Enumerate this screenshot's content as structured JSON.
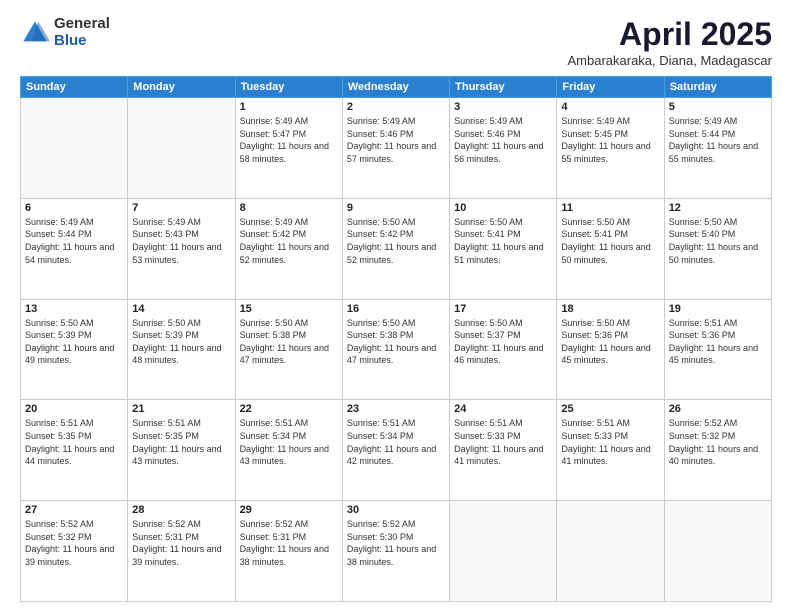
{
  "header": {
    "logo_general": "General",
    "logo_blue": "Blue",
    "month_title": "April 2025",
    "location": "Ambarakaraka, Diana, Madagascar"
  },
  "weekdays": [
    "Sunday",
    "Monday",
    "Tuesday",
    "Wednesday",
    "Thursday",
    "Friday",
    "Saturday"
  ],
  "weeks": [
    [
      {
        "day": "",
        "info": ""
      },
      {
        "day": "",
        "info": ""
      },
      {
        "day": "1",
        "info": "Sunrise: 5:49 AM\nSunset: 5:47 PM\nDaylight: 11 hours and 58 minutes."
      },
      {
        "day": "2",
        "info": "Sunrise: 5:49 AM\nSunset: 5:46 PM\nDaylight: 11 hours and 57 minutes."
      },
      {
        "day": "3",
        "info": "Sunrise: 5:49 AM\nSunset: 5:46 PM\nDaylight: 11 hours and 56 minutes."
      },
      {
        "day": "4",
        "info": "Sunrise: 5:49 AM\nSunset: 5:45 PM\nDaylight: 11 hours and 55 minutes."
      },
      {
        "day": "5",
        "info": "Sunrise: 5:49 AM\nSunset: 5:44 PM\nDaylight: 11 hours and 55 minutes."
      }
    ],
    [
      {
        "day": "6",
        "info": "Sunrise: 5:49 AM\nSunset: 5:44 PM\nDaylight: 11 hours and 54 minutes."
      },
      {
        "day": "7",
        "info": "Sunrise: 5:49 AM\nSunset: 5:43 PM\nDaylight: 11 hours and 53 minutes."
      },
      {
        "day": "8",
        "info": "Sunrise: 5:49 AM\nSunset: 5:42 PM\nDaylight: 11 hours and 52 minutes."
      },
      {
        "day": "9",
        "info": "Sunrise: 5:50 AM\nSunset: 5:42 PM\nDaylight: 11 hours and 52 minutes."
      },
      {
        "day": "10",
        "info": "Sunrise: 5:50 AM\nSunset: 5:41 PM\nDaylight: 11 hours and 51 minutes."
      },
      {
        "day": "11",
        "info": "Sunrise: 5:50 AM\nSunset: 5:41 PM\nDaylight: 11 hours and 50 minutes."
      },
      {
        "day": "12",
        "info": "Sunrise: 5:50 AM\nSunset: 5:40 PM\nDaylight: 11 hours and 50 minutes."
      }
    ],
    [
      {
        "day": "13",
        "info": "Sunrise: 5:50 AM\nSunset: 5:39 PM\nDaylight: 11 hours and 49 minutes."
      },
      {
        "day": "14",
        "info": "Sunrise: 5:50 AM\nSunset: 5:39 PM\nDaylight: 11 hours and 48 minutes."
      },
      {
        "day": "15",
        "info": "Sunrise: 5:50 AM\nSunset: 5:38 PM\nDaylight: 11 hours and 47 minutes."
      },
      {
        "day": "16",
        "info": "Sunrise: 5:50 AM\nSunset: 5:38 PM\nDaylight: 11 hours and 47 minutes."
      },
      {
        "day": "17",
        "info": "Sunrise: 5:50 AM\nSunset: 5:37 PM\nDaylight: 11 hours and 46 minutes."
      },
      {
        "day": "18",
        "info": "Sunrise: 5:50 AM\nSunset: 5:36 PM\nDaylight: 11 hours and 45 minutes."
      },
      {
        "day": "19",
        "info": "Sunrise: 5:51 AM\nSunset: 5:36 PM\nDaylight: 11 hours and 45 minutes."
      }
    ],
    [
      {
        "day": "20",
        "info": "Sunrise: 5:51 AM\nSunset: 5:35 PM\nDaylight: 11 hours and 44 minutes."
      },
      {
        "day": "21",
        "info": "Sunrise: 5:51 AM\nSunset: 5:35 PM\nDaylight: 11 hours and 43 minutes."
      },
      {
        "day": "22",
        "info": "Sunrise: 5:51 AM\nSunset: 5:34 PM\nDaylight: 11 hours and 43 minutes."
      },
      {
        "day": "23",
        "info": "Sunrise: 5:51 AM\nSunset: 5:34 PM\nDaylight: 11 hours and 42 minutes."
      },
      {
        "day": "24",
        "info": "Sunrise: 5:51 AM\nSunset: 5:33 PM\nDaylight: 11 hours and 41 minutes."
      },
      {
        "day": "25",
        "info": "Sunrise: 5:51 AM\nSunset: 5:33 PM\nDaylight: 11 hours and 41 minutes."
      },
      {
        "day": "26",
        "info": "Sunrise: 5:52 AM\nSunset: 5:32 PM\nDaylight: 11 hours and 40 minutes."
      }
    ],
    [
      {
        "day": "27",
        "info": "Sunrise: 5:52 AM\nSunset: 5:32 PM\nDaylight: 11 hours and 39 minutes."
      },
      {
        "day": "28",
        "info": "Sunrise: 5:52 AM\nSunset: 5:31 PM\nDaylight: 11 hours and 39 minutes."
      },
      {
        "day": "29",
        "info": "Sunrise: 5:52 AM\nSunset: 5:31 PM\nDaylight: 11 hours and 38 minutes."
      },
      {
        "day": "30",
        "info": "Sunrise: 5:52 AM\nSunset: 5:30 PM\nDaylight: 11 hours and 38 minutes."
      },
      {
        "day": "",
        "info": ""
      },
      {
        "day": "",
        "info": ""
      },
      {
        "day": "",
        "info": ""
      }
    ]
  ]
}
